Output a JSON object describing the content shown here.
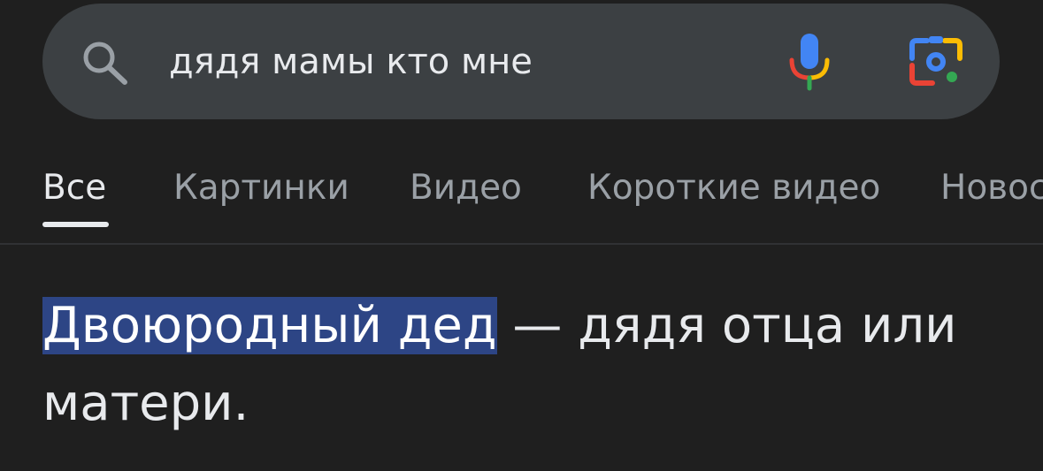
{
  "search": {
    "query": "дядя мамы кто мне"
  },
  "tabs": [
    {
      "label": "Все",
      "active": true
    },
    {
      "label": "Картинки",
      "active": false
    },
    {
      "label": "Видео",
      "active": false
    },
    {
      "label": "Короткие видео",
      "active": false
    },
    {
      "label": "Новос",
      "active": false
    }
  ],
  "answer": {
    "highlight": "Двоюродный дед",
    "rest_line1": " — дядя отца или",
    "rest_line2": "матери."
  },
  "icons": {
    "search": "search-icon",
    "mic": "mic-icon",
    "lens": "google-lens-icon"
  },
  "colors": {
    "background": "#1f1f1f",
    "search_bar": "#3c4043",
    "highlight": "#2d4585",
    "text_primary": "#e8eaed",
    "text_secondary": "#9aa0a6"
  }
}
